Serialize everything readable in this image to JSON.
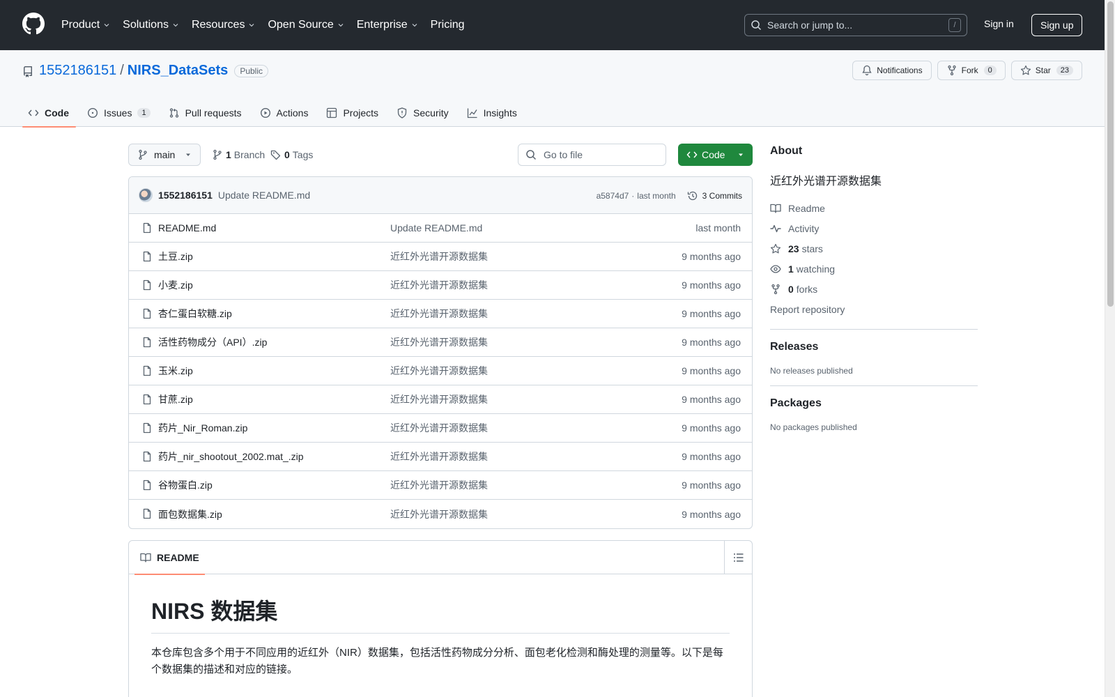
{
  "header": {
    "nav": [
      {
        "label": "Product",
        "dropdown": true
      },
      {
        "label": "Solutions",
        "dropdown": true
      },
      {
        "label": "Resources",
        "dropdown": true
      },
      {
        "label": "Open Source",
        "dropdown": true
      },
      {
        "label": "Enterprise",
        "dropdown": true
      },
      {
        "label": "Pricing",
        "dropdown": false
      }
    ],
    "search_placeholder": "Search or jump to...",
    "search_shortcut": "/",
    "signin": "Sign in",
    "signup": "Sign up"
  },
  "repo": {
    "owner": "1552186151",
    "separator": "/",
    "name": "NIRS_DataSets",
    "visibility": "Public",
    "actions": {
      "notifications": "Notifications",
      "fork": "Fork",
      "fork_count": "0",
      "star": "Star",
      "star_count": "23"
    },
    "tabs": [
      {
        "label": "Code",
        "icon": "code-icon",
        "active": true
      },
      {
        "label": "Issues",
        "icon": "issue-icon",
        "count": "1"
      },
      {
        "label": "Pull requests",
        "icon": "pull-request-icon"
      },
      {
        "label": "Actions",
        "icon": "play-icon"
      },
      {
        "label": "Projects",
        "icon": "table-icon"
      },
      {
        "label": "Security",
        "icon": "shield-icon"
      },
      {
        "label": "Insights",
        "icon": "graph-icon"
      }
    ]
  },
  "toolbar": {
    "branch": "main",
    "branch_count": "1",
    "branch_label": "Branch",
    "tag_count": "0",
    "tag_label": "Tags",
    "go_to_file": "Go to file",
    "code_button": "Code"
  },
  "commit": {
    "author": "1552186151",
    "message": "Update README.md",
    "sha": "a5874d7",
    "dot": "·",
    "time": "last month",
    "commits": "3 Commits"
  },
  "files": [
    {
      "name": "README.md",
      "message": "Update README.md",
      "date": "last month"
    },
    {
      "name": "土豆.zip",
      "message": "近红外光谱开源数据集",
      "date": "9 months ago"
    },
    {
      "name": "小麦.zip",
      "message": "近红外光谱开源数据集",
      "date": "9 months ago"
    },
    {
      "name": "杏仁蛋白软糖.zip",
      "message": "近红外光谱开源数据集",
      "date": "9 months ago"
    },
    {
      "name": "活性药物成分（API）.zip",
      "message": "近红外光谱开源数据集",
      "date": "9 months ago"
    },
    {
      "name": "玉米.zip",
      "message": "近红外光谱开源数据集",
      "date": "9 months ago"
    },
    {
      "name": "甘蔗.zip",
      "message": "近红外光谱开源数据集",
      "date": "9 months ago"
    },
    {
      "name": "药片_Nir_Roman.zip",
      "message": "近红外光谱开源数据集",
      "date": "9 months ago"
    },
    {
      "name": "药片_nir_shootout_2002.mat_.zip",
      "message": "近红外光谱开源数据集",
      "date": "9 months ago"
    },
    {
      "name": "谷物蛋白.zip",
      "message": "近红外光谱开源数据集",
      "date": "9 months ago"
    },
    {
      "name": "面包数据集.zip",
      "message": "近红外光谱开源数据集",
      "date": "9 months ago"
    }
  ],
  "readme": {
    "tab": "README",
    "title": "NIRS 数据集",
    "intro": "本仓库包含多个用于不同应用的近红外（NIR）数据集，包括活性药物成分分析、面包老化检测和酶处理的测量等。以下是每个数据集的描述和对应的链接。"
  },
  "sidebar": {
    "about_title": "About",
    "description": "近红外光谱开源数据集",
    "readme": "Readme",
    "activity": "Activity",
    "stars_count": "23",
    "stars_label": "stars",
    "watching_count": "1",
    "watching_label": "watching",
    "forks_count": "0",
    "forks_label": "forks",
    "report": "Report repository",
    "releases_title": "Releases",
    "releases_empty": "No releases published",
    "packages_title": "Packages",
    "packages_empty": "No packages published"
  },
  "colors": {
    "header_bg": "#24292f",
    "link": "#0969da",
    "code_button": "#1f883d",
    "active_tab_underline": "#fd8c73"
  }
}
